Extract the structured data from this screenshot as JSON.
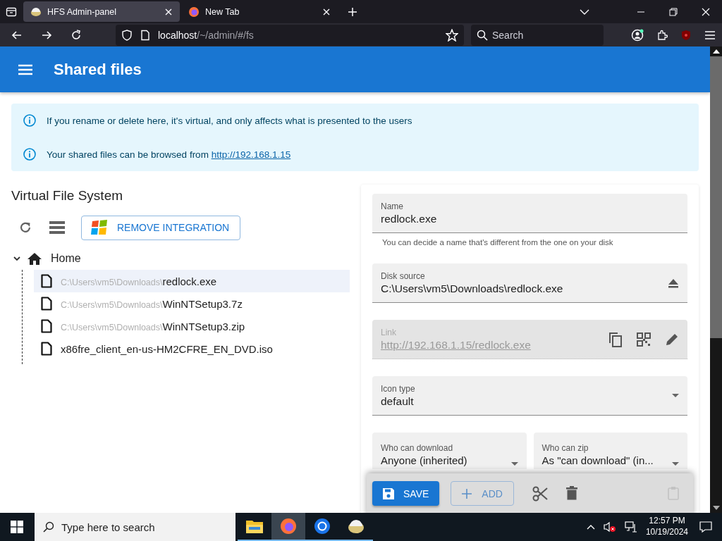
{
  "browser": {
    "tabs": [
      {
        "title": "HFS Admin-panel",
        "kind": "hfs",
        "selected": true
      },
      {
        "title": "New Tab",
        "kind": "firefox",
        "selected": false
      }
    ],
    "address": {
      "host": "localhost",
      "path": "/~/admin/#/fs"
    },
    "search": {
      "placeholder": "Search"
    }
  },
  "app_bar": {
    "title": "Shared files"
  },
  "alerts": [
    {
      "text": "If you rename or delete here, it's virtual, and only affects what is presented to the users"
    },
    {
      "text": "Your shared files can be browsed from ",
      "link": "http://192.168.1.15"
    }
  ],
  "vfs": {
    "title": "Virtual File System",
    "integration_button": "REMOVE INTEGRATION",
    "tree": {
      "label": "Home",
      "expanded": true,
      "children": [
        {
          "dir": "C:\\Users\\vm5\\Downloads\\",
          "name": "redlock.exe",
          "selected": true
        },
        {
          "dir": "C:\\Users\\vm5\\Downloads\\",
          "name": "WinNTSetup3.7z",
          "selected": false
        },
        {
          "dir": "C:\\Users\\vm5\\Downloads\\",
          "name": "WinNTSetup3.zip",
          "selected": false
        },
        {
          "name": "x86fre_client_en-us-HM2CFRE_EN_DVD.iso",
          "selected": false
        }
      ]
    }
  },
  "details": {
    "fields": [
      {
        "kind": "text",
        "label": "Name",
        "value": "redlock.exe",
        "helper": "You can decide a name that's different from the one on your disk",
        "disabled": false
      },
      {
        "kind": "source",
        "label": "Disk source",
        "value": "C:\\Users\\vm5\\Downloads\\redlock.exe",
        "disabled": false
      },
      {
        "kind": "link",
        "label": "Link",
        "value": "http://192.168.1.15/redlock.exe",
        "disabled": true
      },
      {
        "kind": "select",
        "label": "Icon type",
        "value": "default",
        "disabled": false
      }
    ],
    "permissions": [
      {
        "label": "Who can download",
        "value": "Anyone (inherited)"
      },
      {
        "label": "Who can zip",
        "value": "As \"can download\" (in..."
      }
    ]
  },
  "toolbar": {
    "save": "SAVE",
    "add": "ADD",
    "paste_disabled": true
  },
  "taskbar": {
    "search_placeholder": "Type here to search",
    "time": "12:57 PM",
    "date": "10/19/2024",
    "apps": [
      {
        "kind": "folder",
        "selected": false
      },
      {
        "kind": "firefox",
        "selected": true
      },
      {
        "kind": "chrome",
        "selected": false
      },
      {
        "kind": "hfs",
        "selected": false
      }
    ]
  }
}
